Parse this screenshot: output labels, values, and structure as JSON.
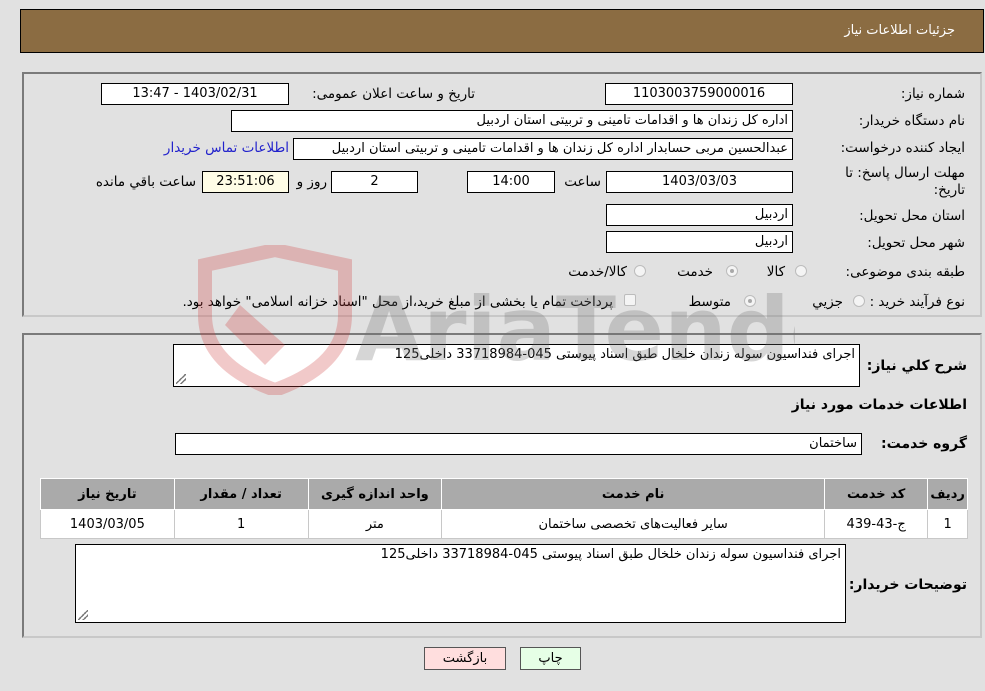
{
  "header": {
    "title": "جزئیات اطلاعات نیاز"
  },
  "form": {
    "need_number": {
      "label": "شماره نیاز:",
      "value": "1103003759000016"
    },
    "announce_datetime": {
      "label": "تاریخ و ساعت اعلان عمومی:",
      "value": "1403/02/31 - 13:47"
    },
    "buyer_org": {
      "label": "نام دستگاه خریدار:",
      "value": "اداره کل زندان ها و اقدامات تامینی و تربیتی استان اردبیل"
    },
    "requester": {
      "label": "ایجاد کننده درخواست:",
      "value": "عبدالحسین مربی حسابدار اداره کل زندان ها و اقدامات تامینی و تربیتی استان اردبیل",
      "contact_link": "اطلاعات تماس خریدار"
    },
    "deadline": {
      "label": "مهلت ارسال پاسخ: تا تاریخ:",
      "date": "1403/03/03",
      "time_label": "ساعت",
      "time": "14:00",
      "days": "2",
      "days_label": "روز و",
      "remaining": "23:51:06",
      "remaining_label": "ساعت باقي مانده"
    },
    "delivery_province": {
      "label": "استان محل تحویل:",
      "value": "اردبیل"
    },
    "delivery_city": {
      "label": "شهر محل تحویل:",
      "value": "اردبیل"
    },
    "category": {
      "label": "طبقه بندی موضوعی:",
      "options": [
        "کالا",
        "خدمت",
        "کالا/خدمت"
      ],
      "selected": "خدمت"
    },
    "purchase_type": {
      "label": "نوع فرآیند خرید :",
      "options": [
        "جزيي",
        "متوسط"
      ],
      "selected": "متوسط",
      "treasury_note": "پرداخت تمام یا بخشی از مبلغ خرید،از محل \"اسناد خزانه اسلامی\" خواهد بود."
    }
  },
  "details": {
    "summary_label": "شرح کلي نياز:",
    "summary_value": "اجرای فنداسیون سوله زندان خلخال طبق اسناد پیوستی 045-33718984 داخلی125",
    "services_heading": "اطلاعات خدمات مورد نیاز",
    "service_group_label": "گروه خدمت:",
    "service_group_value": "ساختمان",
    "table": {
      "headers": [
        "ردیف",
        "کد خدمت",
        "نام خدمت",
        "واحد اندازه گیری",
        "تعداد / مقدار",
        "تاریخ نیاز"
      ],
      "rows": [
        [
          "1",
          "ج-43-439",
          "سایر فعالیت‌های تخصصی ساختمان",
          "متر",
          "1",
          "1403/03/05"
        ]
      ]
    },
    "buyer_notes_label": "توضیحات خریدار:",
    "buyer_notes_value": "اجرای فنداسیون سوله زندان خلخال طبق اسناد پیوستی 045-33718984 داخلی125"
  },
  "buttons": {
    "print": "چاپ",
    "back": "بازگشت"
  },
  "watermark": {
    "text": "AriaTender.neT"
  },
  "colors": {
    "header_bg": "#8b6c42",
    "link": "#2222cc",
    "back_btn": "#ffdede",
    "print_btn": "#e6ffe6"
  }
}
